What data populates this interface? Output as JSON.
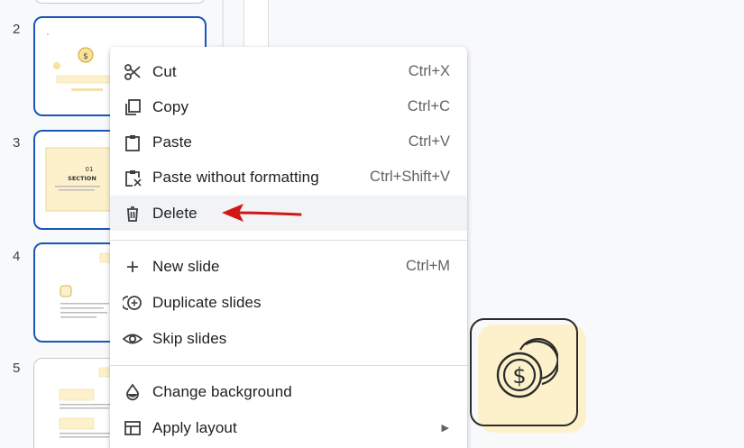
{
  "filmstrip": {
    "slides": [
      {
        "number": "2",
        "title": "",
        "selected": true
      },
      {
        "number": "3",
        "title_line1": "01",
        "title_line2": "SECTION",
        "selected": true
      },
      {
        "number": "4",
        "selected": true
      },
      {
        "number": "5",
        "selected": false
      }
    ]
  },
  "context_menu": {
    "items": [
      {
        "icon": "scissors-icon",
        "label": "Cut",
        "shortcut": "Ctrl+X"
      },
      {
        "icon": "copy-icon",
        "label": "Copy",
        "shortcut": "Ctrl+C"
      },
      {
        "icon": "clipboard-icon",
        "label": "Paste",
        "shortcut": "Ctrl+V"
      },
      {
        "icon": "paste-plain-icon",
        "label": "Paste without formatting",
        "shortcut": "Ctrl+Shift+V"
      },
      {
        "icon": "trash-icon",
        "label": "Delete",
        "shortcut": "",
        "highlighted": true
      },
      {
        "icon": "plus-icon",
        "label": "New slide",
        "shortcut": "Ctrl+M"
      },
      {
        "icon": "duplicate-icon",
        "label": "Duplicate slides",
        "shortcut": ""
      },
      {
        "icon": "eye-icon",
        "label": "Skip slides",
        "shortcut": ""
      },
      {
        "icon": "drop-icon",
        "label": "Change background",
        "shortcut": ""
      },
      {
        "icon": "layout-icon",
        "label": "Apply layout",
        "shortcut": "",
        "submenu": true
      }
    ]
  },
  "annotation": {
    "arrow_color": "#d01616",
    "points_to": "Delete"
  },
  "canvas": {
    "tile_icon": "coins-dollar-icon",
    "tile_color": "#fdf1cc"
  },
  "colors": {
    "selection_border": "#1a56b8",
    "menu_highlight": "#f1f3f4"
  }
}
